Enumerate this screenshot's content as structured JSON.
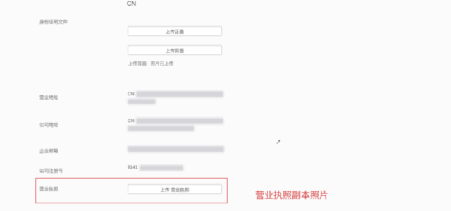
{
  "header": {
    "country_value": "CN"
  },
  "form": {
    "label_a": "身份证明文件",
    "upload_button_1": "上传正面",
    "upload_button_2": "上传背面",
    "upload_hint": "上传背面 · 照片已上传",
    "address_label": "营业地址",
    "address_value_line1": "CN",
    "address_value_line2": "",
    "office_label": "公司地址",
    "office_value": "CN",
    "email_label": "企业邮箱",
    "reg_label": "公司注册号",
    "reg_value": "9141",
    "license_label": "营业执照",
    "license_button": "上传 营业执照"
  },
  "annotation": {
    "text": "营业执照副本照片",
    "color": "#d73a3a"
  }
}
